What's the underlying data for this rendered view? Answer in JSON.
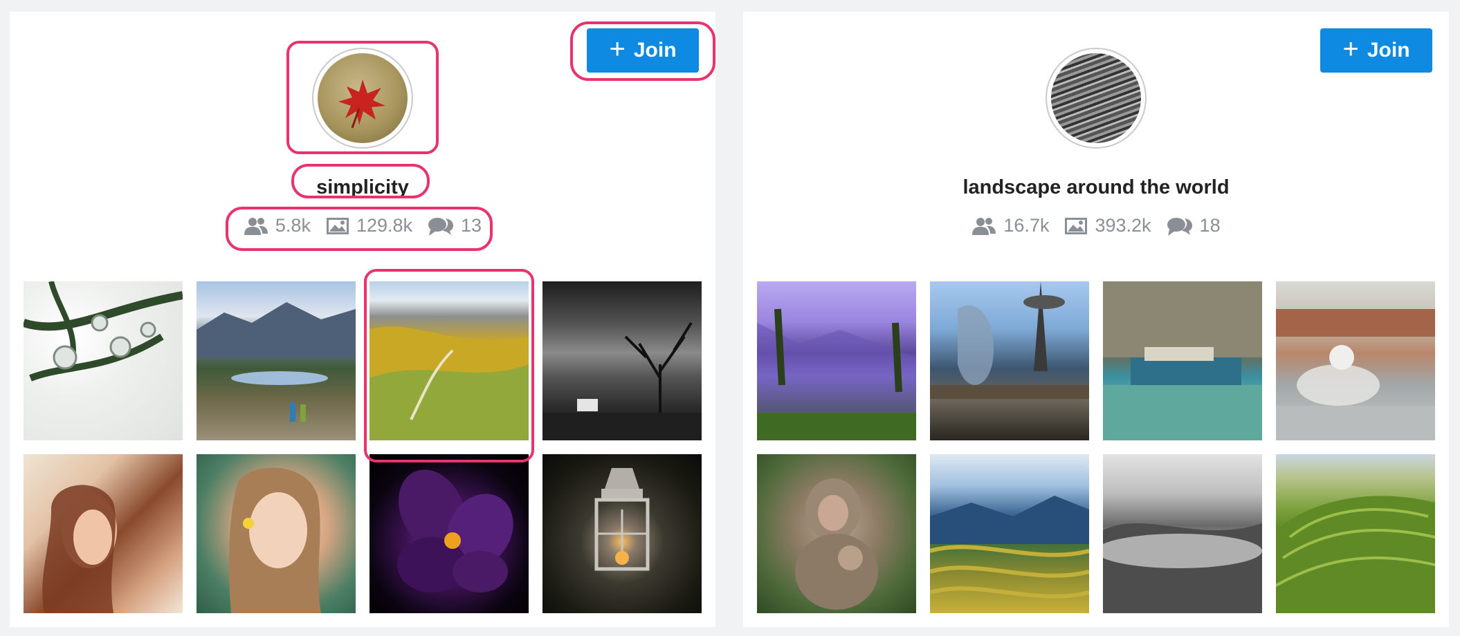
{
  "cards": [
    {
      "join_label": "Join",
      "title": "simplicity",
      "stats": {
        "members": "5.8k",
        "photos": "129.8k",
        "comments": "13"
      },
      "avatar_icon": "maple-leaf-avatar",
      "thumbnails": [
        "water-drops-photo",
        "mountain-valley-photo",
        "green-hills-photo",
        "bw-tree-photo",
        "woman-portrait-photo",
        "girl-portrait-photo",
        "purple-flower-photo",
        "lantern-photo"
      ]
    },
    {
      "join_label": "Join",
      "title": "landscape around the world",
      "stats": {
        "members": "16.7k",
        "photos": "393.2k",
        "comments": "18"
      },
      "avatar_icon": "stone-texture-avatar",
      "thumbnails": [
        "purple-lake-photo",
        "space-needle-photo",
        "boats-cliff-photo",
        "motorbike-photo",
        "monkey-photo",
        "rice-terrace-photo",
        "foggy-forest-photo",
        "vineyard-photo"
      ]
    }
  ],
  "colors": {
    "join_button": "#0f8ae2",
    "highlight": "#e8336d",
    "stat_text": "#8a8f95",
    "background": "#f1f2f4"
  }
}
